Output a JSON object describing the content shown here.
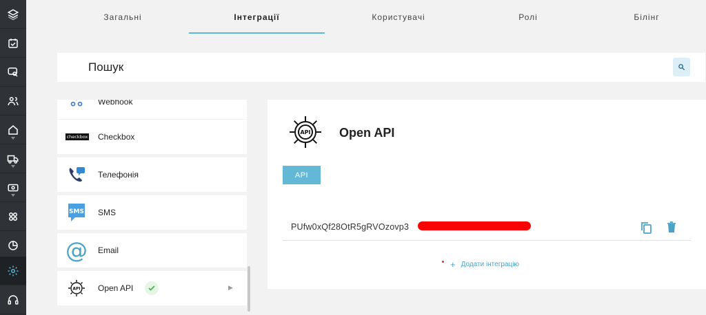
{
  "sidebar": {
    "items": [
      {
        "icon": "layers-icon"
      },
      {
        "icon": "calendar-check-icon"
      },
      {
        "icon": "chat-search-icon"
      },
      {
        "icon": "users-icon"
      },
      {
        "icon": "home-icon"
      },
      {
        "icon": "truck-icon"
      },
      {
        "icon": "cash-icon"
      },
      {
        "icon": "apps-icon"
      },
      {
        "icon": "pie-chart-icon"
      },
      {
        "icon": "gear-icon"
      },
      {
        "icon": "headset-icon"
      }
    ],
    "active_icon": "gear-icon"
  },
  "tabs": [
    {
      "label": "Загальні"
    },
    {
      "label": "Інтеграції"
    },
    {
      "label": "Користувачі"
    },
    {
      "label": "Ролі"
    },
    {
      "label": "Білінг"
    }
  ],
  "active_tab": "Інтеграції",
  "search": {
    "label": "Пошук",
    "icon": "search-icon"
  },
  "integrations": [
    {
      "label": "Webhook",
      "icon": "webhook-icon"
    },
    {
      "label": "Checkbox",
      "icon": "checkbox-logo",
      "logo_text": "checkbox"
    },
    {
      "label": "Телефонія",
      "icon": "phone-icon"
    },
    {
      "label": "SMS",
      "icon": "sms-icon",
      "icon_text": "SMS"
    },
    {
      "label": "Email",
      "icon": "at-icon"
    },
    {
      "label": "Open API",
      "icon": "api-gear-icon",
      "icon_text": "API"
    }
  ],
  "detail": {
    "title": "Open API",
    "logo_text": "API",
    "button_label": "API",
    "api_key": "PUfw0xQf28OtR5gRVOzovp3",
    "add_label": "Додати інтеграцію"
  },
  "colors": {
    "accent": "#5bb7d8",
    "rail": "#2f3337",
    "success": "#4caf50",
    "redaction": "#ff0000"
  }
}
